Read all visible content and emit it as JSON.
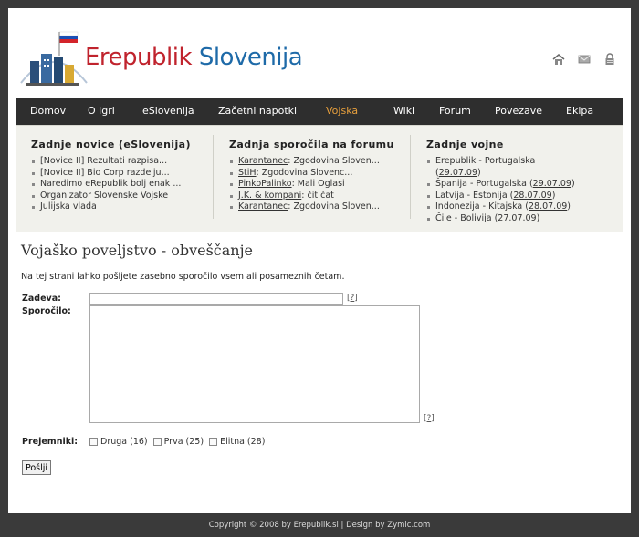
{
  "header": {
    "title_part1": "Erepublik",
    "title_part2": "Slovenija",
    "icons": [
      "home-icon",
      "mail-icon",
      "lock-icon"
    ]
  },
  "nav": {
    "items": [
      {
        "label": "Domov"
      },
      {
        "label": "O igri"
      },
      {
        "label": "eSlovenija"
      },
      {
        "label": "Začetni napotki"
      },
      {
        "label": "Vojska",
        "active": true
      },
      {
        "label": "Wiki"
      },
      {
        "label": "Forum"
      },
      {
        "label": "Povezave"
      },
      {
        "label": "Ekipa"
      }
    ]
  },
  "news": {
    "col1": {
      "title": "Zadnje novice (eSlovenija)",
      "items": [
        "[Novice II] Rezultati razpisa...",
        "[Novice II] Bio Corp razdelju...",
        "Naredimo eRepublik bolj enak ...",
        "Organizator Slovenske Vojske",
        "Julijska vlada"
      ]
    },
    "col2": {
      "title": "Zadnja sporočila na forumu",
      "items": [
        {
          "user": "Karantanec",
          "text": ": Zgodovina Sloven..."
        },
        {
          "user": "StiH",
          "text": ": Zgodovina Slovenc..."
        },
        {
          "user": "PinkoPalinko",
          "text": ": Mali Oglasi"
        },
        {
          "user": "J.K. & kompani",
          "text": ": čit čat"
        },
        {
          "user": "Karantanec",
          "text": ": Zgodovina Sloven..."
        }
      ]
    },
    "col3": {
      "title": "Zadnje vojne",
      "items": [
        {
          "text": "Erepublik - Portugalska",
          "date": "29.07.09",
          "wrap": true
        },
        {
          "text": "Španija - Portugalska",
          "date": "29.07.09"
        },
        {
          "text": "Latvija - Estonija",
          "date": "28.07.09"
        },
        {
          "text": "Indonezija - Kitajska",
          "date": "28.07.09"
        },
        {
          "text": "Čile - Bolivija",
          "date": "27.07.09"
        }
      ]
    }
  },
  "content": {
    "heading": "Vojaško poveljstvo - obveščanje",
    "intro": "Na tej strani lahko pošljete zasebno sporočilo vsem ali posameznih četam.",
    "subject_label": "Zadeva:",
    "message_label": "Sporočilo:",
    "help": "?",
    "recipients_label": "Prejemniki:",
    "recipients": [
      "Druga (16)",
      "Prva (25)",
      "Elitna (28)"
    ],
    "send_label": "Pošlji"
  },
  "footer": {
    "text": "Copyright © 2008 by Erepublik.si | Design by Zymic.com"
  }
}
